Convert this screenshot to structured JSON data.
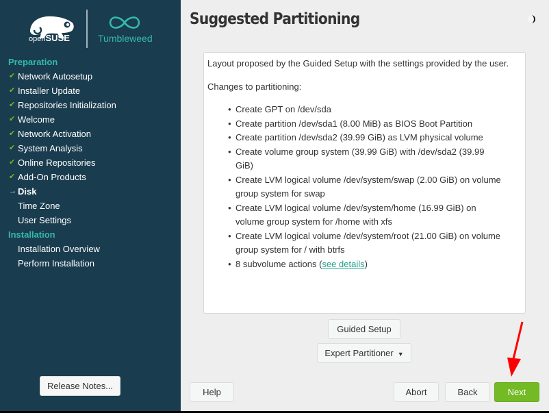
{
  "branding": {
    "logo_text_light": "open",
    "logo_text_bold": "SUSE",
    "product_name": "Tumbleweed"
  },
  "colors": {
    "sidebar_bg": "#1a3c4f",
    "accent_teal": "#35b9ab",
    "check_green": "#73ba25",
    "next_button": "#73ba25",
    "link": "#1f9f86",
    "annotation_arrow": "#ff0000"
  },
  "sidebar": {
    "sections": [
      {
        "title": "Preparation",
        "steps": [
          {
            "label": "Network Autosetup",
            "status": "done",
            "icon": "check-icon"
          },
          {
            "label": "Installer Update",
            "status": "done",
            "icon": "check-icon"
          },
          {
            "label": "Repositories Initialization",
            "status": "done",
            "icon": "check-icon"
          },
          {
            "label": "Welcome",
            "status": "done",
            "icon": "check-icon"
          },
          {
            "label": "Network Activation",
            "status": "done",
            "icon": "check-icon"
          },
          {
            "label": "System Analysis",
            "status": "done",
            "icon": "check-icon"
          },
          {
            "label": "Online Repositories",
            "status": "done",
            "icon": "check-icon"
          },
          {
            "label": "Add-On Products",
            "status": "done",
            "icon": "check-icon"
          },
          {
            "label": "Disk",
            "status": "current",
            "icon": "arrow-right-icon"
          },
          {
            "label": "Time Zone",
            "status": "pending"
          },
          {
            "label": "User Settings",
            "status": "pending"
          }
        ]
      },
      {
        "title": "Installation",
        "steps": [
          {
            "label": "Installation Overview",
            "status": "pending"
          },
          {
            "label": "Perform Installation",
            "status": "pending"
          }
        ]
      }
    ],
    "release_notes_label": "Release Notes..."
  },
  "main": {
    "title": "Suggested Partitioning",
    "theme_toggle_icon": "half-moon-icon",
    "intro": "Layout proposed by the Guided Setup with the settings provided by the user.",
    "changes_heading": "Changes to partitioning:",
    "changes": [
      "Create GPT on /dev/sda",
      "Create partition /dev/sda1 (8.00 MiB) as BIOS Boot Partition",
      "Create partition /dev/sda2 (39.99 GiB) as LVM physical volume",
      "Create volume group system (39.99 GiB) with /dev/sda2 (39.99 GiB)",
      "Create LVM logical volume /dev/system/swap (2.00 GiB) on volume group system for swap",
      "Create LVM logical volume /dev/system/home (16.99 GiB) on volume group system for /home with xfs",
      "Create LVM logical volume /dev/system/root (21.00 GiB) on volume group system for / with btrfs"
    ],
    "subvolume_prefix": "8 subvolume actions (",
    "subvolume_link": "see details",
    "subvolume_suffix": ")",
    "guided_setup_label": "Guided Setup",
    "expert_partitioner_label": "Expert Partitioner"
  },
  "footer": {
    "help_label": "Help",
    "abort_label": "Abort",
    "back_label": "Back",
    "next_label": "Next"
  }
}
